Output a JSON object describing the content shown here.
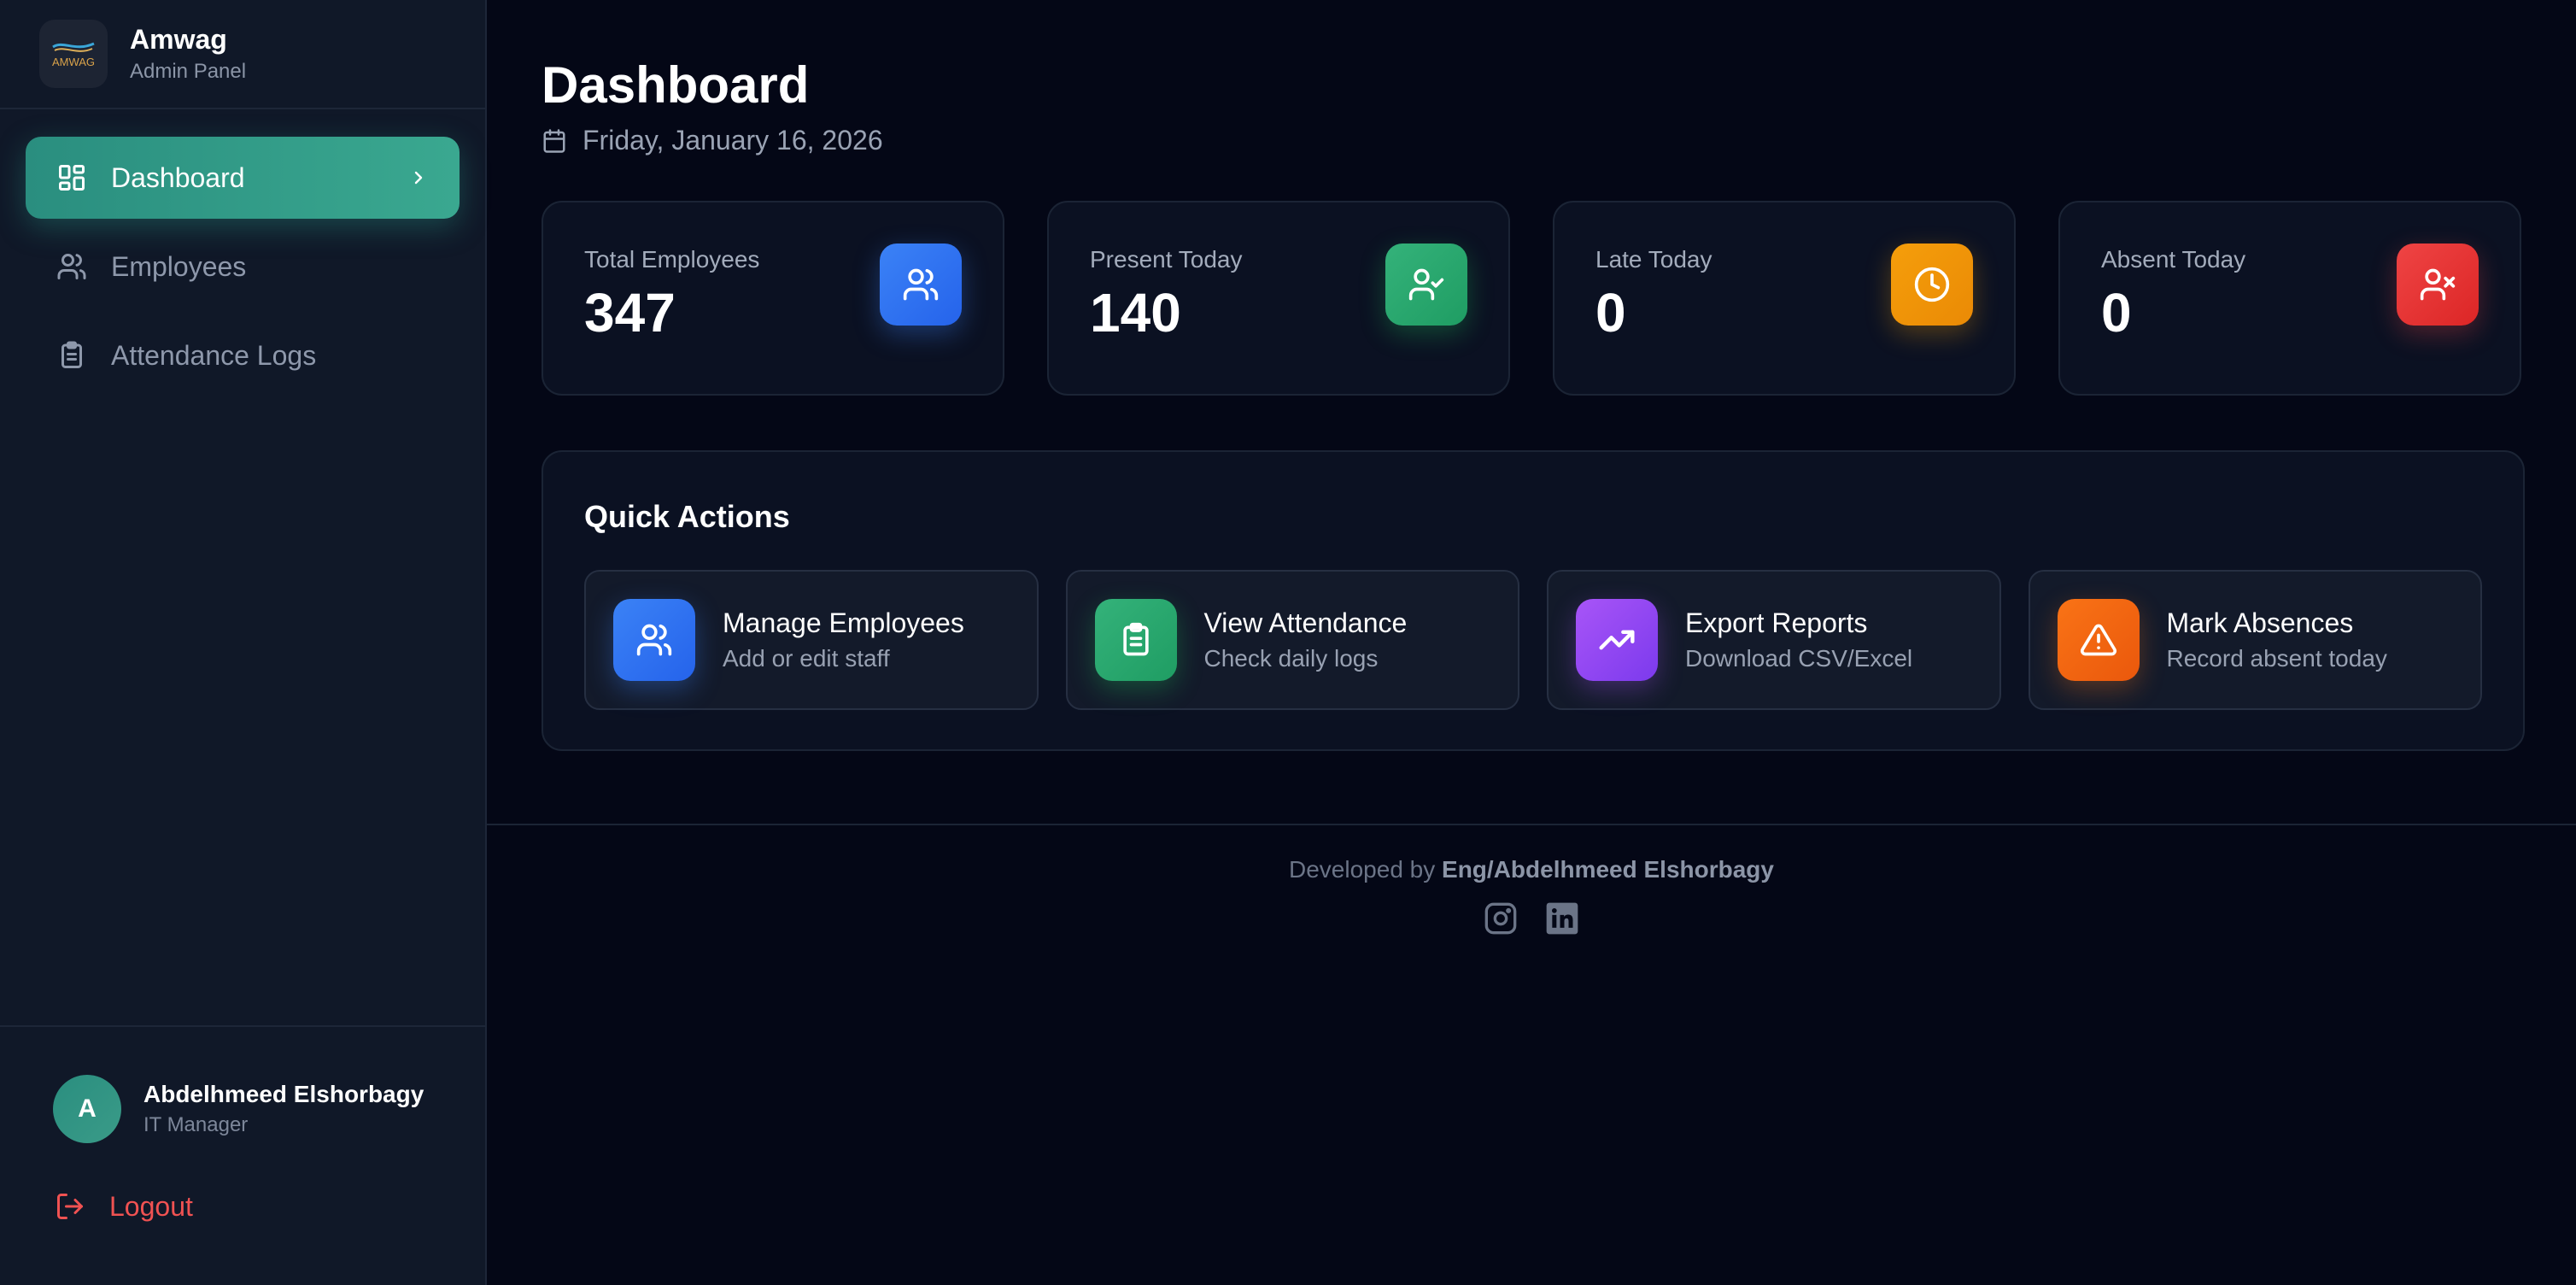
{
  "brand": {
    "name": "Amwag",
    "subtitle": "Admin Panel",
    "logo_icon": "amwag-logo"
  },
  "sidebar": {
    "items": [
      {
        "label": "Dashboard",
        "icon": "dashboard-icon",
        "active": true
      },
      {
        "label": "Employees",
        "icon": "users-icon",
        "active": false
      },
      {
        "label": "Attendance Logs",
        "icon": "clipboard-icon",
        "active": false
      }
    ]
  },
  "user": {
    "initial": "A",
    "name": "Abdelhmeed Elshorbagy",
    "role": "IT Manager"
  },
  "logout": {
    "label": "Logout",
    "icon": "logout-icon"
  },
  "header": {
    "title": "Dashboard",
    "date": "Friday, January 16, 2026"
  },
  "stats": [
    {
      "label": "Total Employees",
      "value": "347",
      "icon": "users-icon",
      "color": "#3b82f6"
    },
    {
      "label": "Present Today",
      "value": "140",
      "icon": "user-check-icon",
      "color": "#22c55e"
    },
    {
      "label": "Late Today",
      "value": "0",
      "icon": "clock-icon",
      "color": "#f59e0b"
    },
    {
      "label": "Absent Today",
      "value": "0",
      "icon": "user-x-icon",
      "color": "#ef4444"
    }
  ],
  "quick_actions": {
    "title": "Quick Actions",
    "items": [
      {
        "label": "Manage Employees",
        "description": "Add or edit staff",
        "icon": "users-icon",
        "color": "#3b82f6"
      },
      {
        "label": "View Attendance",
        "description": "Check daily logs",
        "icon": "clipboard-icon",
        "color": "#22c55e"
      },
      {
        "label": "Export Reports",
        "description": "Download CSV/Excel",
        "icon": "trending-up-icon",
        "color": "#a855f7"
      },
      {
        "label": "Mark Absences",
        "description": "Record absent today",
        "icon": "alert-triangle-icon",
        "color": "#f97316"
      }
    ]
  },
  "footer": {
    "prefix": "Developed by",
    "author": "Eng/Abdelhmeed Elshorbagy",
    "socials": [
      "instagram-icon",
      "linkedin-icon"
    ]
  },
  "colors": {
    "accent": "#2a9d8a",
    "background": "#040716",
    "sidebar": "#101828",
    "logout": "#f05252"
  }
}
